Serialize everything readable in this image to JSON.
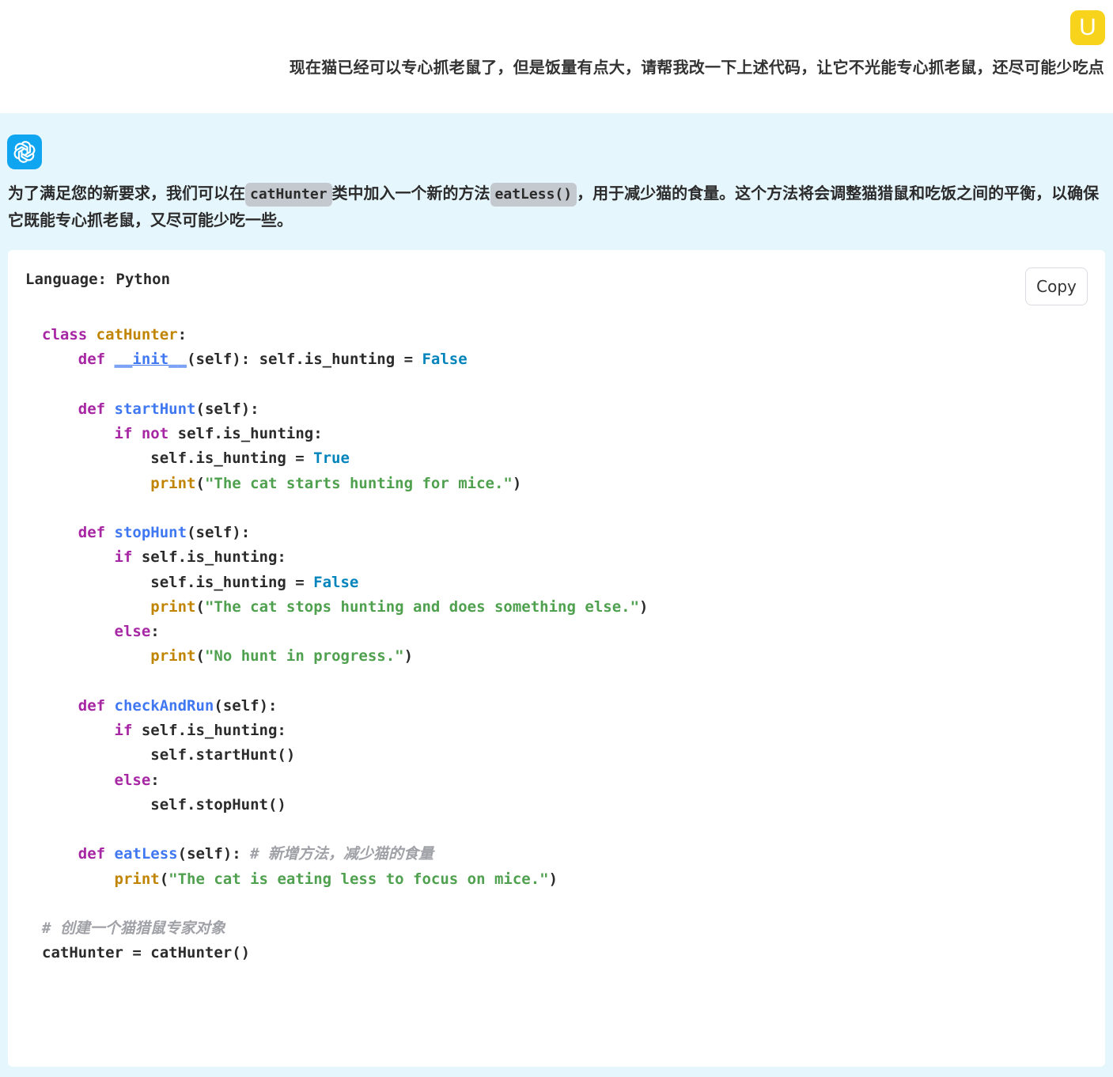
{
  "user": {
    "avatar_letter": "U",
    "avatar_color": "#f8d31b",
    "message": "现在猫已经可以专心抓老鼠了，但是饭量有点大，请帮我改一下上述代码，让它不光能专心抓老鼠，还尽可能少吃点"
  },
  "assistant": {
    "avatar_icon": "openai-logo-icon",
    "avatar_color": "#0fa5f0",
    "intro": {
      "part1": "为了满足您的新要求，我们可以在",
      "code1": "catHunter",
      "part2": "类中加入一个新的方法",
      "code2": "eatLess()",
      "part3": "，用于减少猫的食量。这个方法将会调整猫猎鼠和吃饭之间的平衡，以确保它既能专心抓老鼠，又尽可能少吃一些。"
    },
    "code_block": {
      "language_label": "Language: Python",
      "copy_label": "Copy",
      "lines": [
        "class catHunter:",
        "    def __init__(self): self.is_hunting = False",
        "",
        "    def startHunt(self):",
        "        if not self.is_hunting:",
        "            self.is_hunting = True",
        "            print(\"The cat starts hunting for mice.\")",
        "",
        "    def stopHunt(self):",
        "        if self.is_hunting:",
        "            self.is_hunting = False",
        "            print(\"The cat stops hunting and does something else.\")",
        "        else:",
        "            print(\"No hunt in progress.\")",
        "",
        "    def checkAndRun(self):",
        "        if self.is_hunting:",
        "            self.startHunt()",
        "        else:",
        "            self.stopHunt()",
        "",
        "    def eatLess(self): # 新增方法，减少猫的食量",
        "        print(\"The cat is eating less to focus on mice.\")",
        "",
        "# 创建一个猫猎鼠专家对象",
        "catHunter = catHunter()"
      ]
    }
  },
  "colors": {
    "user_bg": "#ffffff",
    "assistant_bg": "#e6f6fd",
    "code_bg": "#ffffff",
    "keyword": "#a626a4",
    "class_name": "#c18401",
    "function_name": "#4078f2",
    "boolean": "#0184bc",
    "string": "#50a14f",
    "comment": "#a0a1a7"
  }
}
